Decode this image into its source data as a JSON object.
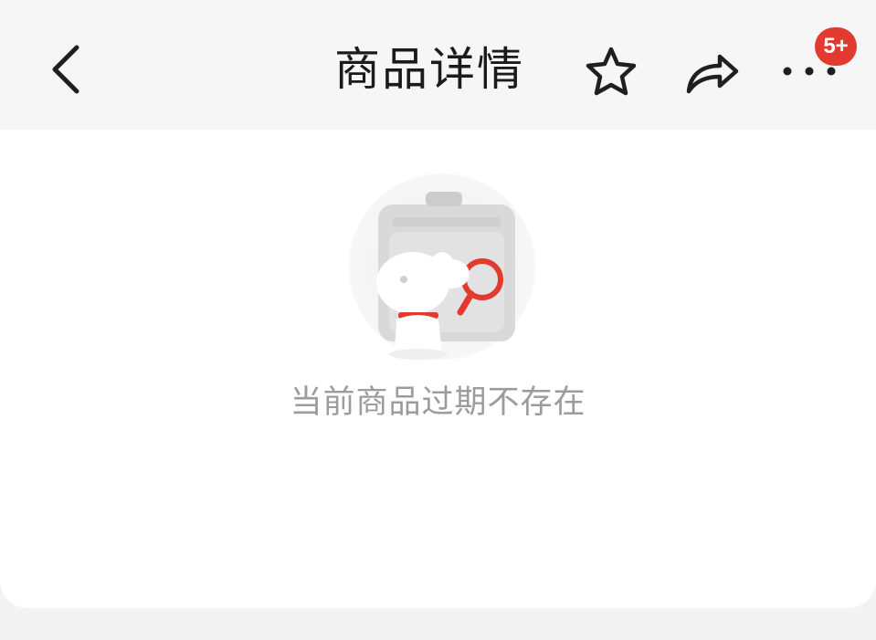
{
  "header": {
    "title": "商品详情",
    "icons": {
      "back": "back-chevron-icon",
      "favorite": "star-icon",
      "share": "share-arrow-icon",
      "more": "more-dots-icon"
    },
    "badge": "5+",
    "badge_color": "#e23a2f"
  },
  "empty_state": {
    "illustration": "mascot-dog-with-magnifier-icon",
    "message": "当前商品过期不存在",
    "accent_color": "#e23a2f"
  }
}
